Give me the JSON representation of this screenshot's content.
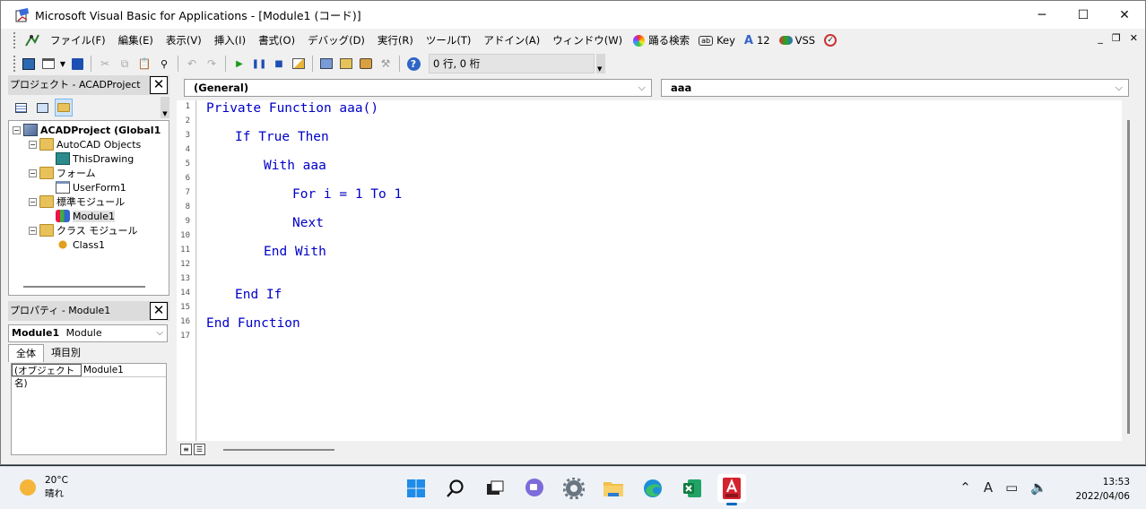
{
  "window": {
    "title": "Microsoft Visual Basic for Applications - [Module1 (コード)]",
    "minimize": "─",
    "maximize": "☐",
    "close": "✕"
  },
  "menu": {
    "items": [
      "ファイル(F)",
      "編集(E)",
      "表示(V)",
      "挿入(I)",
      "書式(O)",
      "デバッグ(D)",
      "実行(R)",
      "ツール(T)",
      "アドイン(A)",
      "ウィンドウ(W)"
    ],
    "tools": [
      {
        "icon": "rainbow-search-icon",
        "label": "踊る検索"
      },
      {
        "icon": "ab-key-icon",
        "label": "Key"
      },
      {
        "icon": "font-size-icon",
        "label": "12"
      },
      {
        "icon": "vss-icon",
        "label": "VSS"
      },
      {
        "icon": "check-circle-icon",
        "label": ""
      }
    ],
    "mdi": {
      "minimize": "_",
      "restore": "❐",
      "close": "✕"
    }
  },
  "toolbar": {
    "status": "0 行, 0 桁"
  },
  "project_panel": {
    "title": "プロジェクト - ACADProject",
    "tree": [
      {
        "label": "ACADProject (Global1",
        "level": 0,
        "expander": "−",
        "bold": true,
        "icon": "project-icon"
      },
      {
        "label": "AutoCAD Objects",
        "level": 1,
        "expander": "−",
        "icon": "folder-icon"
      },
      {
        "label": "ThisDrawing",
        "level": 2,
        "icon": "drawing-icon"
      },
      {
        "label": "フォーム",
        "level": 1,
        "expander": "−",
        "icon": "folder-icon"
      },
      {
        "label": "UserForm1",
        "level": 2,
        "icon": "form-icon"
      },
      {
        "label": "標準モジュール",
        "level": 1,
        "expander": "−",
        "icon": "folder-icon"
      },
      {
        "label": "Module1",
        "level": 2,
        "icon": "module-icon",
        "selected": true
      },
      {
        "label": "クラス モジュール",
        "level": 1,
        "expander": "−",
        "icon": "folder-icon"
      },
      {
        "label": "Class1",
        "level": 2,
        "icon": "class-icon"
      }
    ]
  },
  "properties_panel": {
    "title": "プロパティ - Module1",
    "object_name": "Module1",
    "object_type": "Module",
    "tabs": [
      "全体",
      "項目別"
    ],
    "rows": [
      {
        "name": "(オブジェクト名)",
        "value": "Module1"
      }
    ]
  },
  "editor": {
    "object_combo": "(General)",
    "proc_combo": "aaa",
    "line_numbers": [
      "1",
      "2",
      "3",
      "4",
      "5",
      "6",
      "7",
      "8",
      "9",
      "10",
      "11",
      "12",
      "13",
      "14",
      "15",
      "16",
      "17"
    ],
    "code_lines": [
      {
        "text": "Private Function aaa()",
        "indent": 0
      },
      {
        "text": "If True Then",
        "indent": 1
      },
      {
        "text": "With aaa",
        "indent": 2
      },
      {
        "text": "For i = 1 To 1",
        "indent": 3
      },
      {
        "text": "Next",
        "indent": 3
      },
      {
        "text": "End With",
        "indent": 2
      },
      {
        "text": "End If",
        "indent": 1
      },
      {
        "text": "End Function",
        "indent": 0
      }
    ]
  },
  "taskbar": {
    "temperature": "20°C",
    "weather": "晴れ",
    "time": "13:53",
    "date": "2022/04/06"
  },
  "colors": {
    "code_keyword": "#0000c8",
    "titlebar": "#ffffff",
    "chrome": "#f0f0f0",
    "accent": "#0067c0"
  }
}
